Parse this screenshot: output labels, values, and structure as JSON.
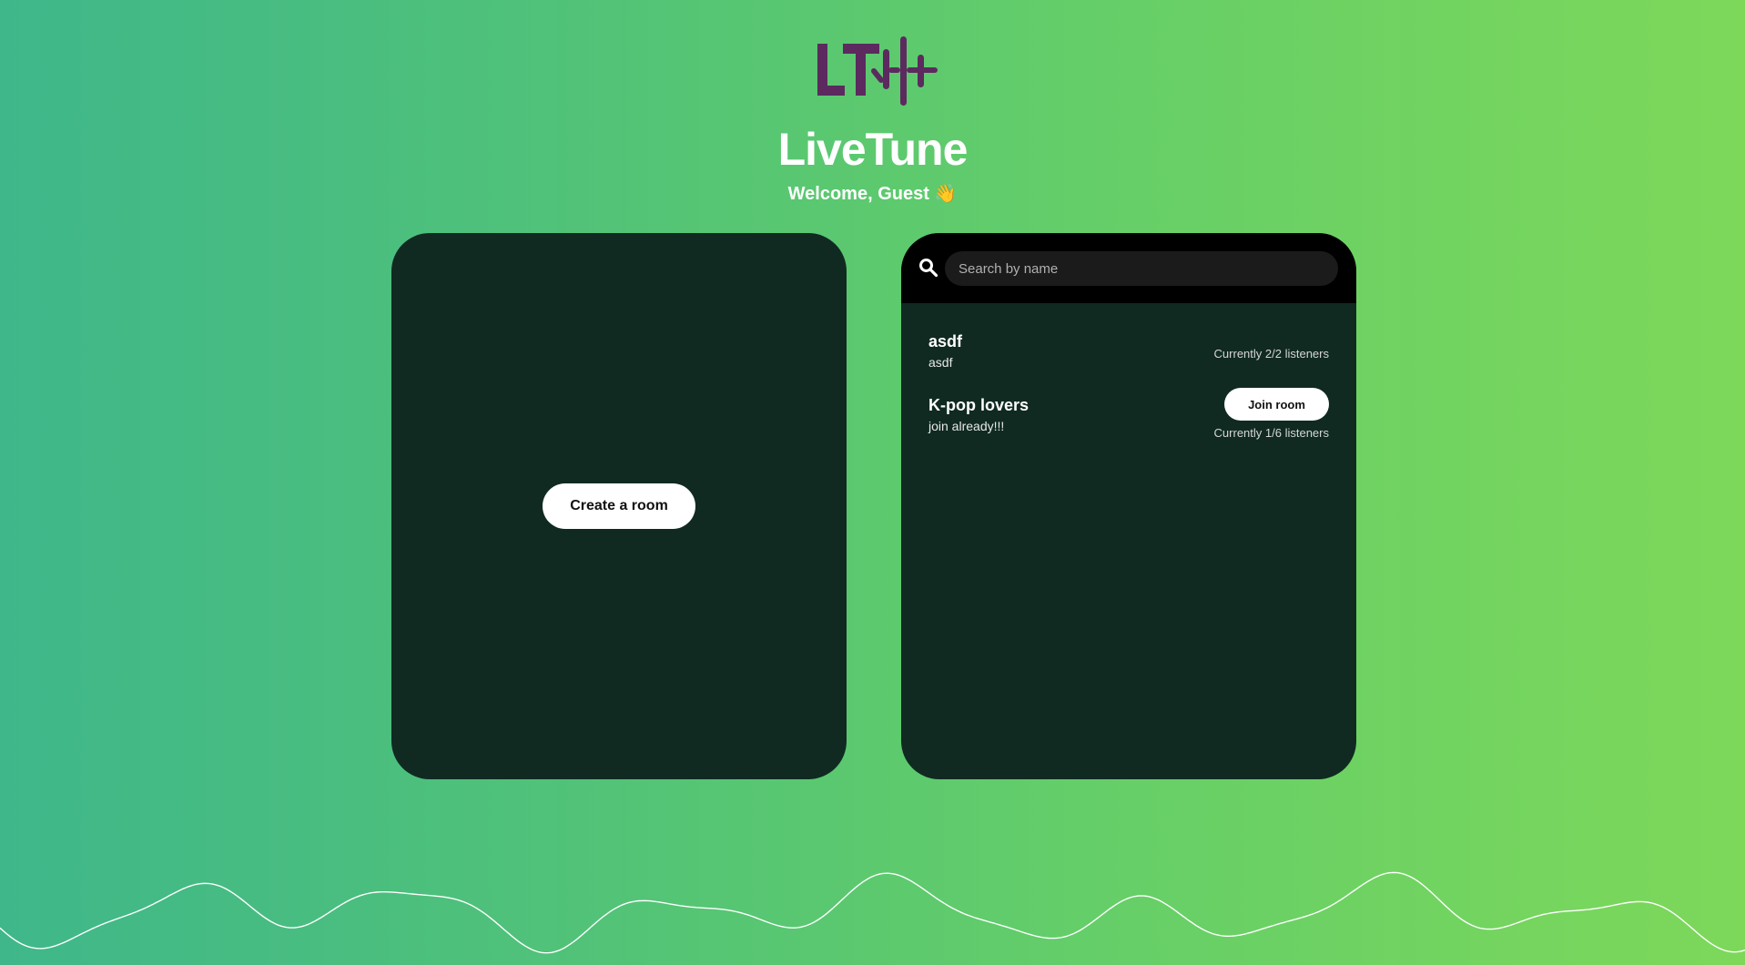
{
  "app": {
    "title": "LiveTune",
    "welcome": "Welcome, Guest 👋",
    "logo_text": "LT"
  },
  "colors": {
    "gradient_start": "#3fb78a",
    "gradient_end": "#7dd85a",
    "panel_bg": "#102a22",
    "logo": "#5c2a5f",
    "button_bg": "#ffffff"
  },
  "create_panel": {
    "create_label": "Create a room"
  },
  "search": {
    "icon": "search-icon",
    "placeholder": "Search by name",
    "value": ""
  },
  "rooms": [
    {
      "name": "asdf",
      "description": "asdf",
      "listeners": "Currently 2/2 listeners",
      "join_visible": false
    },
    {
      "name": "K-pop lovers",
      "description": "join already!!!",
      "listeners": "Currently 1/6 listeners",
      "join_visible": true,
      "join_label": "Join room"
    }
  ]
}
